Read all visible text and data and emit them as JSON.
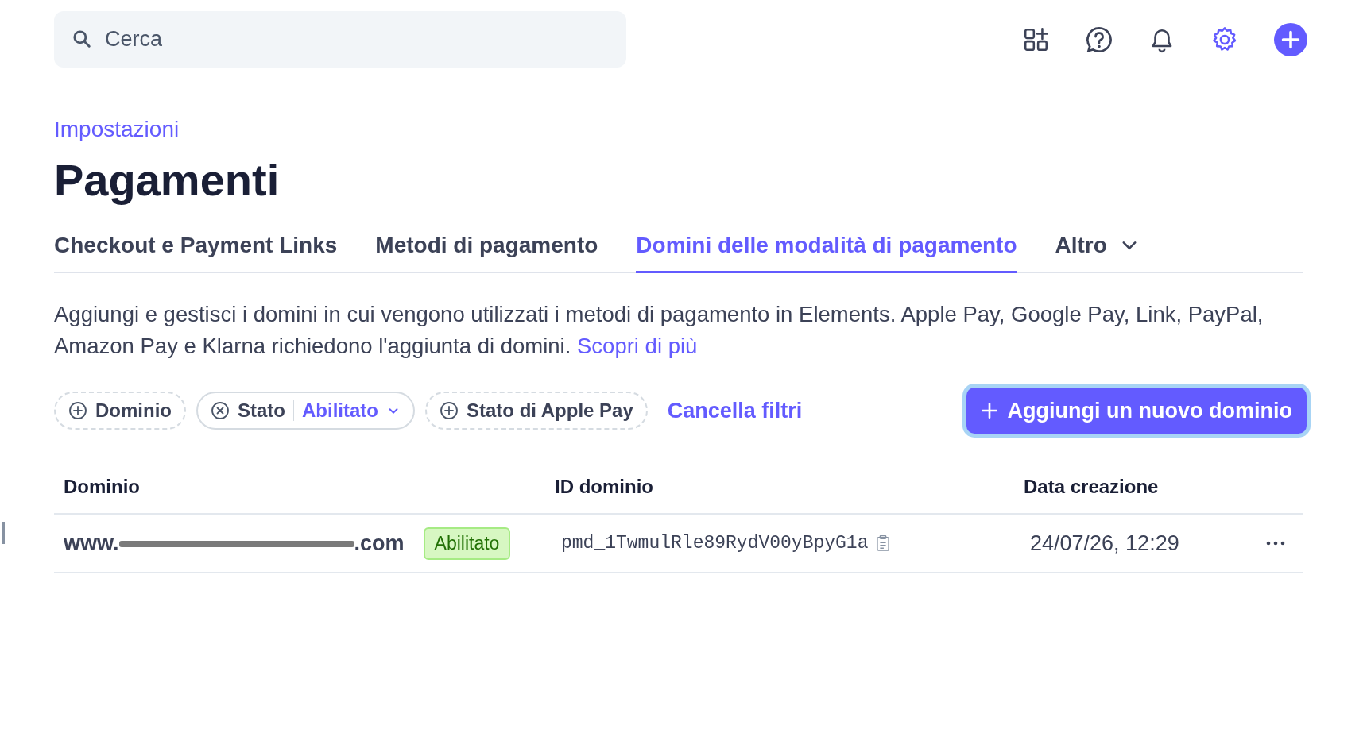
{
  "search": {
    "placeholder": "Cerca"
  },
  "breadcrumb": "Impostazioni",
  "title": "Pagamenti",
  "tabs": [
    {
      "label": "Checkout e Payment Links",
      "selected": false,
      "kind": "tab"
    },
    {
      "label": "Metodi di pagamento",
      "selected": false,
      "kind": "tab"
    },
    {
      "label": "Domini delle modalità di pagamento",
      "selected": true,
      "kind": "tab"
    },
    {
      "label": "Altro",
      "selected": false,
      "kind": "menu"
    }
  ],
  "description": "Aggiungi e gestisci i domini in cui vengono utilizzati i metodi di pagamento in Elements. Apple Pay, Google Pay, Link, PayPal, Amazon Pay e Klarna richiedono l'aggiunta di domini.",
  "learn_more": "Scopri di più",
  "filters": [
    {
      "label": "Dominio",
      "kind": "add"
    },
    {
      "label": "Stato",
      "value": "Abilitato",
      "kind": "applied"
    },
    {
      "label": "Stato di Apple Pay",
      "kind": "add"
    }
  ],
  "clear_filters": "Cancella filtri",
  "add_button": "Aggiungi un nuovo dominio",
  "table": {
    "columns": [
      "Dominio",
      "ID dominio",
      "Data creazione"
    ],
    "rows": [
      {
        "domain_prefix": "www.",
        "domain_suffix": ".com",
        "redacted": true,
        "status": "Abilitato",
        "id": "pmd_1TwmulRle89RydV00yBpyG1a",
        "created": "24/07/26, 12:29"
      }
    ]
  }
}
